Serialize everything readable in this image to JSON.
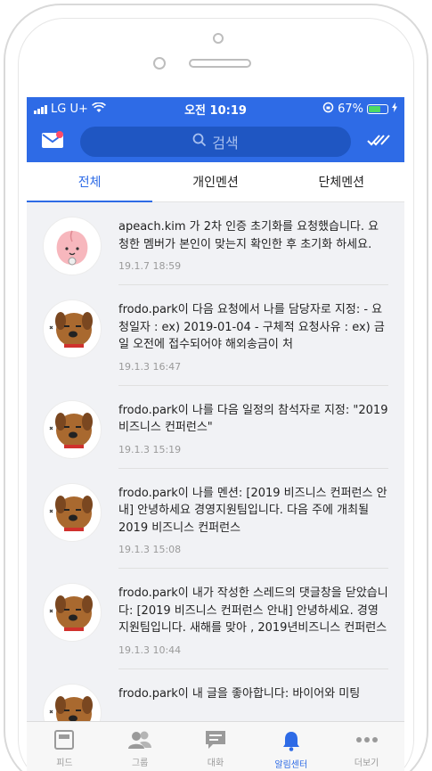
{
  "status_bar": {
    "carrier": "LG U+",
    "time": "오전 10:19",
    "battery": "67%",
    "battery_level": 0.67
  },
  "header": {
    "search_placeholder": "검색",
    "mail_icon": "mail-icon",
    "check_icon": "double-check-icon"
  },
  "tabs": [
    {
      "label": "전체",
      "active": true
    },
    {
      "label": "개인멘션",
      "active": false
    },
    {
      "label": "단체멘션",
      "active": false
    }
  ],
  "notifications": [
    {
      "avatar": "apeach-avatar",
      "message": "apeach.kim 가 2차 인증 초기화를 요청했습니다. 요청한 멤버가 본인이 맞는지 확인한 후 초기화 하세요.",
      "time": "19.1.7 18:59"
    },
    {
      "avatar": "frodo-avatar",
      "message": "frodo.park이 다음 요청에서 나를 담당자로 지정: - 요청일자 : ex) 2019-01-04 - 구체적 요청사유 : ex) 금일 오전에 접수되어야 해외송금이 처",
      "time": "19.1.3 16:47"
    },
    {
      "avatar": "frodo-avatar",
      "message": "frodo.park이 나를 다음 일정의 참석자로 지정: \"2019 비즈니스 컨퍼런스\"",
      "time": "19.1.3 15:19"
    },
    {
      "avatar": "frodo-avatar",
      "message": "frodo.park이 나를 멘션: [2019 비즈니스 컨퍼런스 안내]  안녕하세요 경영지원팀입니다. 다음 주에 개최될 2019 비즈니스 컨퍼런스",
      "time": "19.1.3 15:08"
    },
    {
      "avatar": "frodo-avatar",
      "message": "frodo.park이 내가 작성한 스레드의 댓글창을 닫았습니다: [2019 비즈니스 컨퍼런스 안내]  안녕하세요. 경영지원팀입니다. 새해를 맞아 , 2019년비즈니스 컨퍼런스",
      "time": "19.1.3 10:44"
    },
    {
      "avatar": "frodo-avatar",
      "message": "frodo.park이 내 글을 좋아합니다: 바이어와 미팅",
      "time": ""
    }
  ],
  "bottom_nav": [
    {
      "label": "피드",
      "icon": "feed-icon",
      "active": false
    },
    {
      "label": "그룹",
      "icon": "group-icon",
      "active": false
    },
    {
      "label": "대화",
      "icon": "chat-icon",
      "active": false
    },
    {
      "label": "알림센터",
      "icon": "bell-icon",
      "active": true
    },
    {
      "label": "더보기",
      "icon": "more-icon",
      "active": false
    }
  ],
  "colors": {
    "accent": "#2e6be6",
    "background": "#f1f2f5",
    "badge": "#ff4b6a"
  }
}
